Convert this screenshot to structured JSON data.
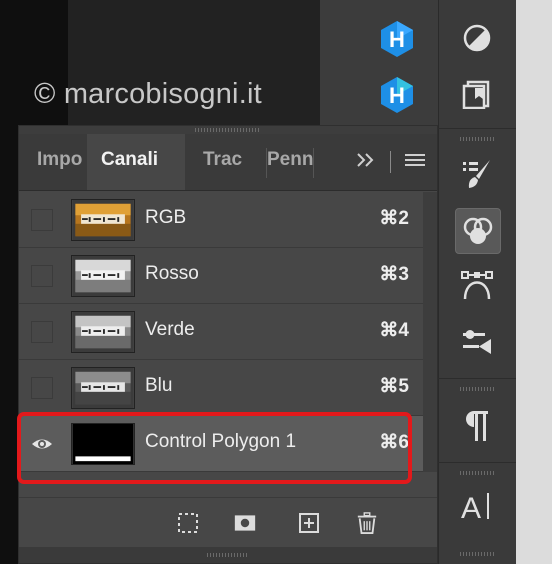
{
  "watermark": "© marcobisogni.it",
  "tabs": [
    {
      "label": "Impo"
    },
    {
      "label": "Canali"
    },
    {
      "label": "Trac"
    },
    {
      "label": "Penn"
    }
  ],
  "tab_overflow": "»",
  "channels": [
    {
      "name": "RGB",
      "shortcut": "⌘2",
      "visible": false
    },
    {
      "name": "Rosso",
      "shortcut": "⌘3",
      "visible": false
    },
    {
      "name": "Verde",
      "shortcut": "⌘4",
      "visible": false
    },
    {
      "name": "Blu",
      "shortcut": "⌘5",
      "visible": false
    },
    {
      "name": "Control Polygon 1",
      "shortcut": "⌘6",
      "visible": true,
      "selected": true
    }
  ],
  "colors": {
    "highlight": "#e3191b",
    "plugin_icon": "#1e8fe6"
  },
  "icons": {
    "plugin_top": "h-logo-icon",
    "plugin_bottom": "h-logo-icon",
    "tools": [
      "adjustments-icon",
      "libraries-icon",
      "brush-presets-icon",
      "channels-icon",
      "paths-icon",
      "properties-icon",
      "paragraph-icon",
      "character-icon"
    ],
    "footer": [
      "load-selection-icon",
      "save-mask-icon",
      "new-channel-icon",
      "trash-icon"
    ]
  }
}
